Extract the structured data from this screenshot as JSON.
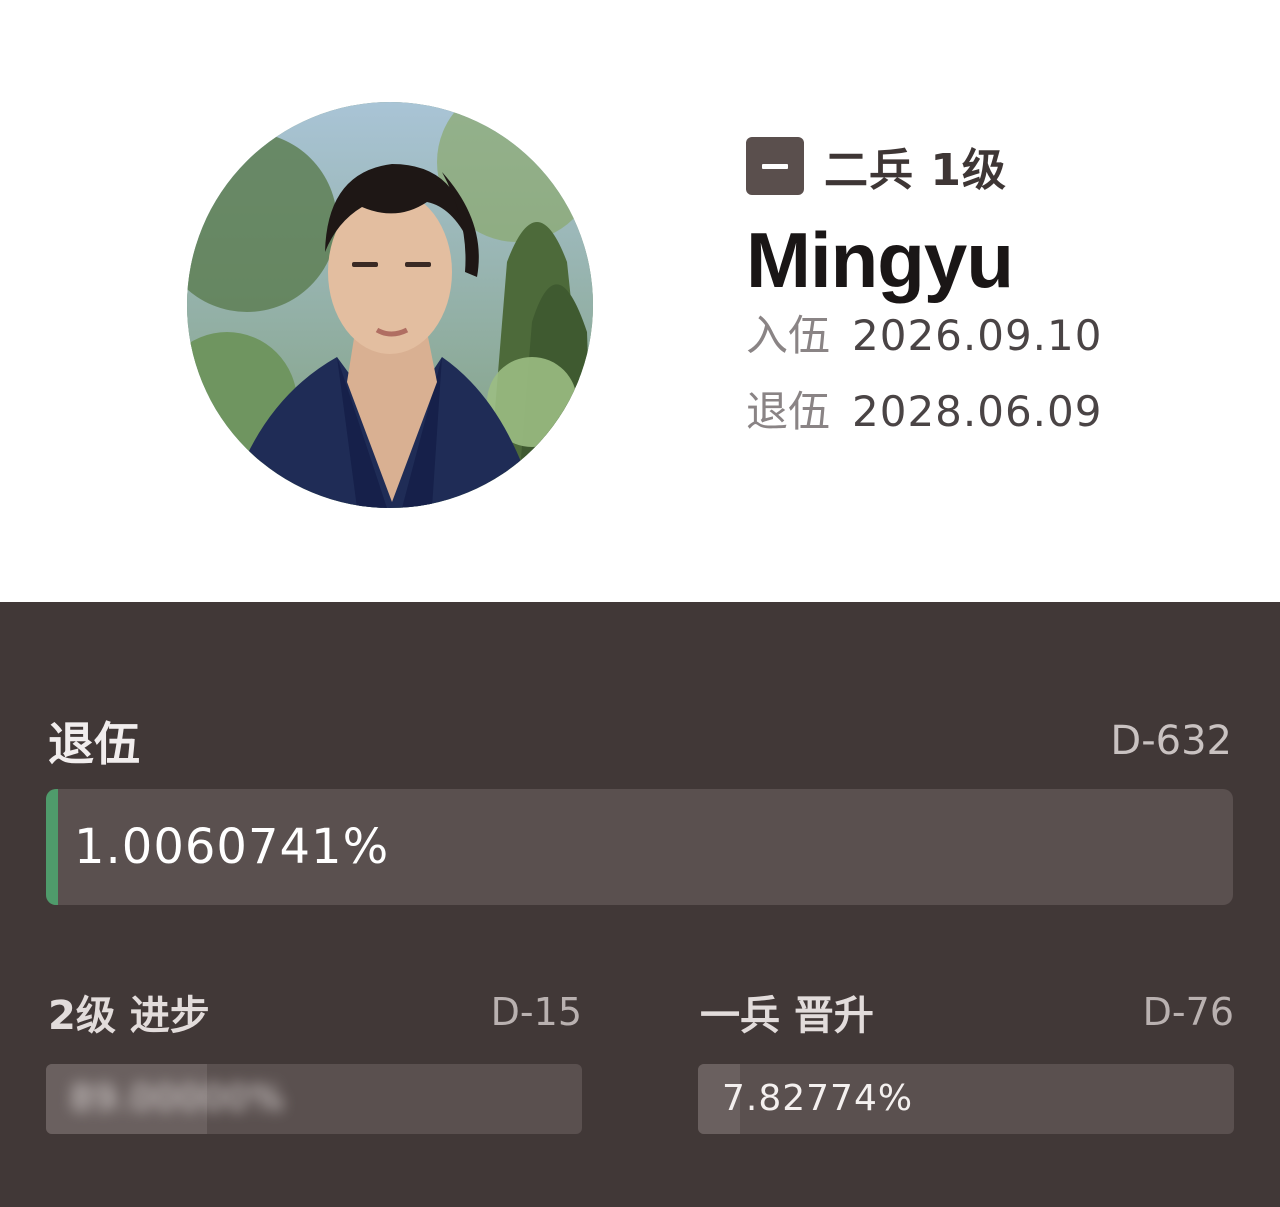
{
  "profile": {
    "rank_badge_icon": "rank-stripe-icon",
    "rank": "二兵 1级",
    "name": "Mingyu",
    "enlist_label": "入伍",
    "enlist_date": "2026.09.10",
    "discharge_label": "退伍",
    "discharge_date": "2028.06.09"
  },
  "discharge": {
    "title": "退伍",
    "dday": "D-632",
    "percent_text": "1.0060741%",
    "progress": 0.010060741,
    "accent_color": "#4f9b6b"
  },
  "grade_progress": {
    "title": "2级 进步",
    "dday": "D-15",
    "percent_text": "89.00000%",
    "progress": 0.3,
    "value_blurred": true
  },
  "promotion": {
    "title": "一兵 晋升",
    "dday": "D-76",
    "percent_text": "7.82774%",
    "progress": 0.0782774
  },
  "colors": {
    "panel_background": "#413837",
    "bar_track": "#5a504f"
  }
}
